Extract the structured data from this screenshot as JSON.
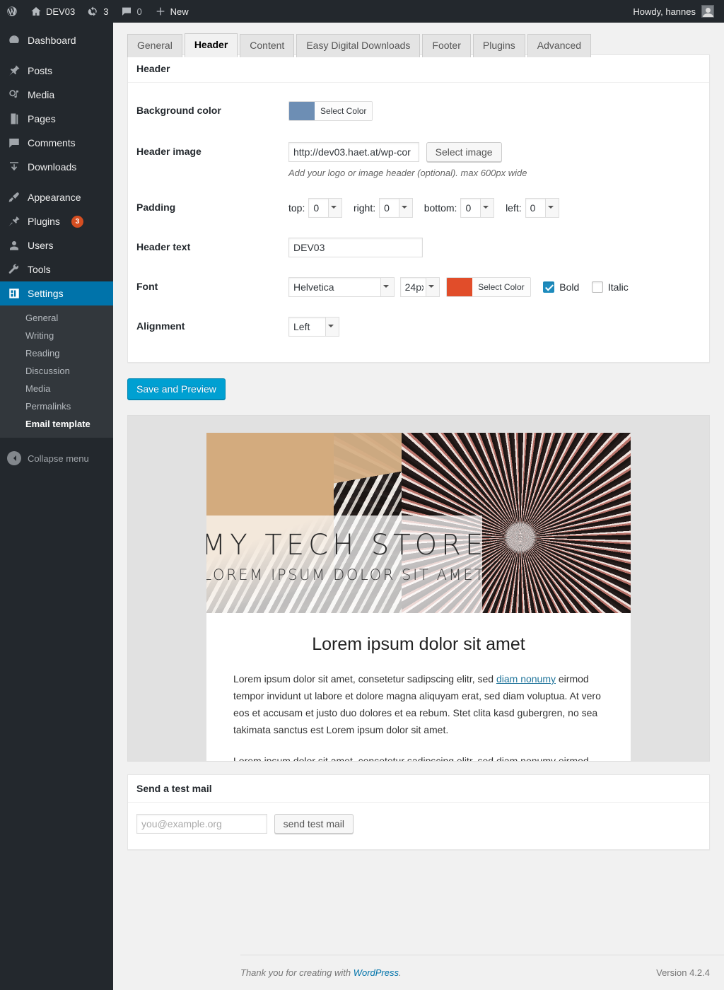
{
  "adminbar": {
    "logo_icon": "wordpress-logo-icon",
    "site_name": "DEV03",
    "updates_count": "3",
    "comments_count": "0",
    "new_label": "New",
    "howdy": "Howdy, hannes"
  },
  "sidebar": {
    "items": [
      {
        "label": "Dashboard",
        "icon": "dashboard-icon"
      },
      {
        "label": "Posts",
        "icon": "pin-icon"
      },
      {
        "label": "Media",
        "icon": "media-icon"
      },
      {
        "label": "Pages",
        "icon": "pages-icon"
      },
      {
        "label": "Comments",
        "icon": "comment-icon"
      },
      {
        "label": "Downloads",
        "icon": "download-icon"
      },
      {
        "label": "Appearance",
        "icon": "brush-icon"
      },
      {
        "label": "Plugins",
        "icon": "plug-icon",
        "badge": "3"
      },
      {
        "label": "Users",
        "icon": "user-icon"
      },
      {
        "label": "Tools",
        "icon": "wrench-icon"
      },
      {
        "label": "Settings",
        "icon": "settings-icon",
        "current": true
      }
    ],
    "submenu": [
      {
        "label": "General"
      },
      {
        "label": "Writing"
      },
      {
        "label": "Reading"
      },
      {
        "label": "Discussion"
      },
      {
        "label": "Media"
      },
      {
        "label": "Permalinks"
      },
      {
        "label": "Email template",
        "current": true
      }
    ],
    "collapse_label": "Collapse menu"
  },
  "tabs": [
    {
      "label": "General",
      "active": false
    },
    {
      "label": "Header",
      "active": true
    },
    {
      "label": "Content",
      "active": false
    },
    {
      "label": "Easy Digital Downloads",
      "active": false
    },
    {
      "label": "Footer",
      "active": false
    },
    {
      "label": "Plugins",
      "active": false
    },
    {
      "label": "Advanced",
      "active": false
    }
  ],
  "header_panel": {
    "title": "Header",
    "rows": {
      "background_color": {
        "label": "Background color",
        "swatch_hex": "#6d8eb4",
        "button_label": "Select Color"
      },
      "header_image": {
        "label": "Header image",
        "value": "http://dev03.haet.at/wp-cor",
        "button_label": "Select image",
        "description": "Add your logo or image header (optional). max 600px wide"
      },
      "padding": {
        "label": "Padding",
        "fields": [
          {
            "label": "top:",
            "value": "0"
          },
          {
            "label": "right:",
            "value": "0"
          },
          {
            "label": "bottom:",
            "value": "0"
          },
          {
            "label": "left:",
            "value": "0"
          }
        ]
      },
      "header_text": {
        "label": "Header text",
        "value": "DEV03"
      },
      "font": {
        "label": "Font",
        "family": "Helvetica",
        "size": "24px",
        "color_hex": "#e14d2a",
        "color_button_label": "Select Color",
        "bold_label": "Bold",
        "bold_checked": true,
        "italic_label": "Italic",
        "italic_checked": false
      },
      "alignment": {
        "label": "Alignment",
        "value": "Left"
      }
    }
  },
  "save_button": "Save and Preview",
  "preview": {
    "hero_title": "MY TECH STORE",
    "hero_subtitle": "LOREM IPSUM DOLOR SIT AMET",
    "heading": "Lorem ipsum dolor sit amet",
    "paragraph_part1": "Lorem ipsum dolor sit amet, consetetur sadipscing elitr, sed ",
    "paragraph_link": "diam nonumy",
    "paragraph_part2": " eirmod tempor invidunt ut labore et dolore magna aliquyam erat, sed diam voluptua. At vero eos et accusam et justo duo dolores et ea rebum. Stet clita kasd gubergren, no sea takimata sanctus est Lorem ipsum dolor sit amet.",
    "paragraph2": "Lorem ipsum dolor sit amet, consetetur sadipscing elitr, sed diam nonumy eirmod tempor"
  },
  "test_mail": {
    "title": "Send a test mail",
    "placeholder": "you@example.org",
    "button_label": "send test mail"
  },
  "footer": {
    "thanks_prefix": "Thank you for creating with ",
    "link": "WordPress",
    "thanks_suffix": ".",
    "version": "Version 4.2.4"
  }
}
